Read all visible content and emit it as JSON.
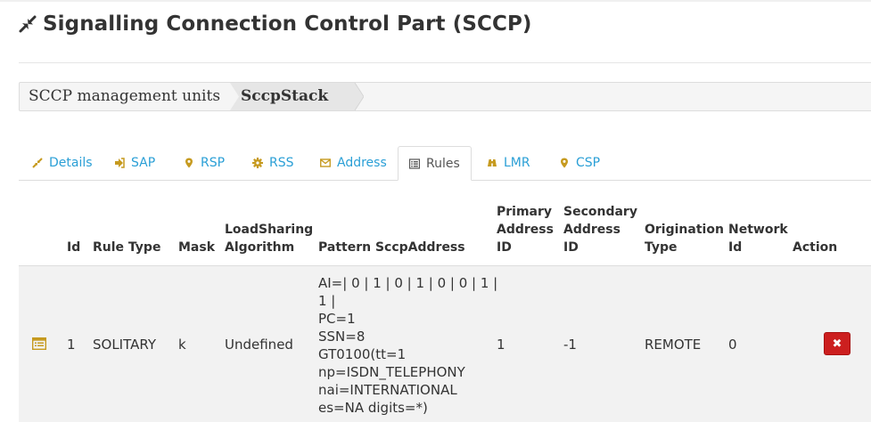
{
  "page": {
    "title": "Signalling Connection Control Part (SCCP)",
    "icon": "compress-arrows-icon"
  },
  "breadcrumb": {
    "items": [
      "SCCP management units",
      "SccpStack"
    ]
  },
  "tabs": [
    {
      "label": "Details",
      "icon": "compress-icon"
    },
    {
      "label": "SAP",
      "icon": "sign-in-icon"
    },
    {
      "label": "RSP",
      "icon": "map-marker-icon"
    },
    {
      "label": "RSS",
      "icon": "gear-icon"
    },
    {
      "label": "Address",
      "icon": "envelope-icon"
    },
    {
      "label": "Rules",
      "icon": "list-alt-icon",
      "active": true
    },
    {
      "label": "LMR",
      "icon": "binoculars-icon"
    },
    {
      "label": "CSP",
      "icon": "map-marker-icon"
    }
  ],
  "table": {
    "headers": {
      "id": "Id",
      "rule_type": "Rule Type",
      "mask": "Mask",
      "lsa_1": "LoadSharing",
      "lsa_2": "Algorithm",
      "pattern": "Pattern SccpAddress",
      "primary_1": "Primary",
      "primary_2": "Address",
      "primary_3": "ID",
      "secondary_1": "Secondary",
      "secondary_2": "Address",
      "secondary_3": "ID",
      "origination_1": "Origination",
      "origination_2": "Type",
      "network_1": "Network",
      "network_2": "Id",
      "action": "Action"
    },
    "rows": [
      {
        "id": "1",
        "rule_type": "SOLITARY",
        "mask": "k",
        "lsa": "Undefined",
        "pattern_lines": [
          "AI=| 0 | 1 | 0 | 1 | 0 | 0 | 1 |",
          "1 |",
          "PC=1",
          "SSN=8",
          "GT0100(tt=1",
          "np=ISDN_TELEPHONY",
          "nai=INTERNATIONAL",
          "es=NA digits=*)"
        ],
        "primary": "1",
        "secondary": "-1",
        "origination": "REMOTE",
        "network": "0",
        "action_icon": "close-icon",
        "action_symbol": "✖"
      }
    ]
  },
  "colors": {
    "link": "#2a9fd6",
    "accent_gold": "#c69a1f",
    "danger": "#cc1f1f"
  }
}
